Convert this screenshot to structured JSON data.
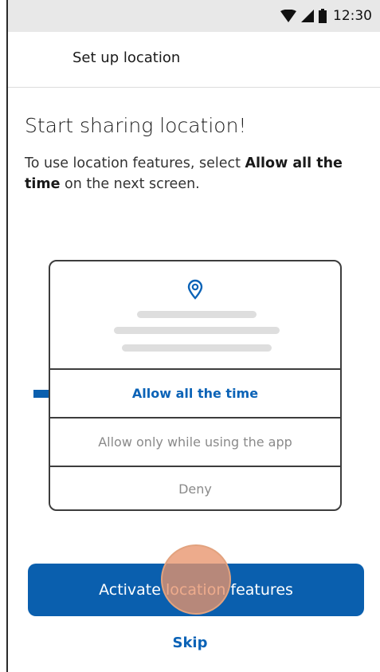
{
  "status_bar": {
    "time": "12:30",
    "icons": [
      "wifi-icon",
      "cellular-signal-icon",
      "battery-icon"
    ]
  },
  "header": {
    "title": "Set up location"
  },
  "content": {
    "headline": "Start sharing location!",
    "instruction_prefix": "To use location features, select ",
    "instruction_emphasis": "Allow all the time",
    "instruction_suffix": " on the next screen."
  },
  "permission_dialog": {
    "icon": "location-pin-icon",
    "options": [
      {
        "label": "Allow all the time",
        "highlighted": true
      },
      {
        "label": "Allow only while using the app",
        "highlighted": false
      },
      {
        "label": "Deny",
        "highlighted": false
      }
    ],
    "pointer": "arrow-right-icon"
  },
  "actions": {
    "primary_label": "Activate location features",
    "skip_label": "Skip"
  },
  "colors": {
    "brand_blue": "#0a5fae",
    "link_blue": "#0b63b7",
    "touch_indicator": "#e8946c",
    "status_bar_bg": "#e8e8e8"
  }
}
